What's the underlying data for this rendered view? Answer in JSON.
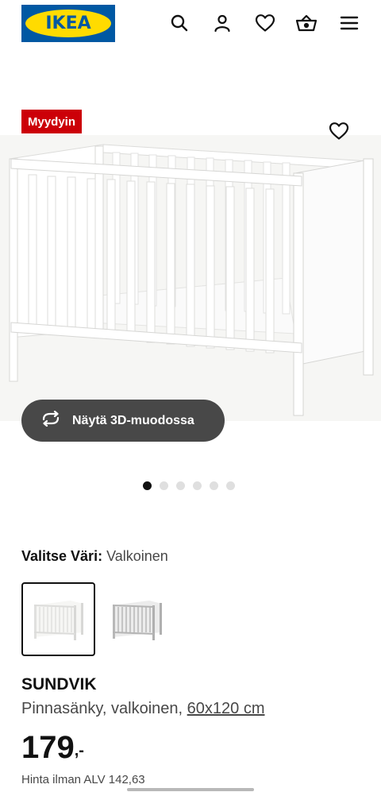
{
  "header": {
    "logo_text": "IKEA",
    "icons": [
      "search-icon",
      "user-icon",
      "heart-icon",
      "basket-icon",
      "menu-icon"
    ]
  },
  "product": {
    "badge": "Myydyin",
    "image_alt": "crib",
    "view_3d_label": "Näytä 3D-muodossa",
    "gallery": {
      "count": 6,
      "active_index": 0
    },
    "color_label": "Valitse Väri:",
    "color_value": "Valkoinen",
    "variants": [
      {
        "name": "white-crib",
        "selected": true
      },
      {
        "name": "grey-crib",
        "selected": false
      }
    ],
    "name": "SUNDVIK",
    "description": "Pinnasänky, valkoinen, ",
    "size_link": "60x120 cm",
    "price_int": "179",
    "price_dec": ",-",
    "vat_text": "Hinta ilman ALV 142,63"
  },
  "colors": {
    "ikea_blue": "#0058a3",
    "ikea_yellow": "#ffdb00",
    "badge_red": "#cc0008",
    "button_dark": "#484848"
  }
}
